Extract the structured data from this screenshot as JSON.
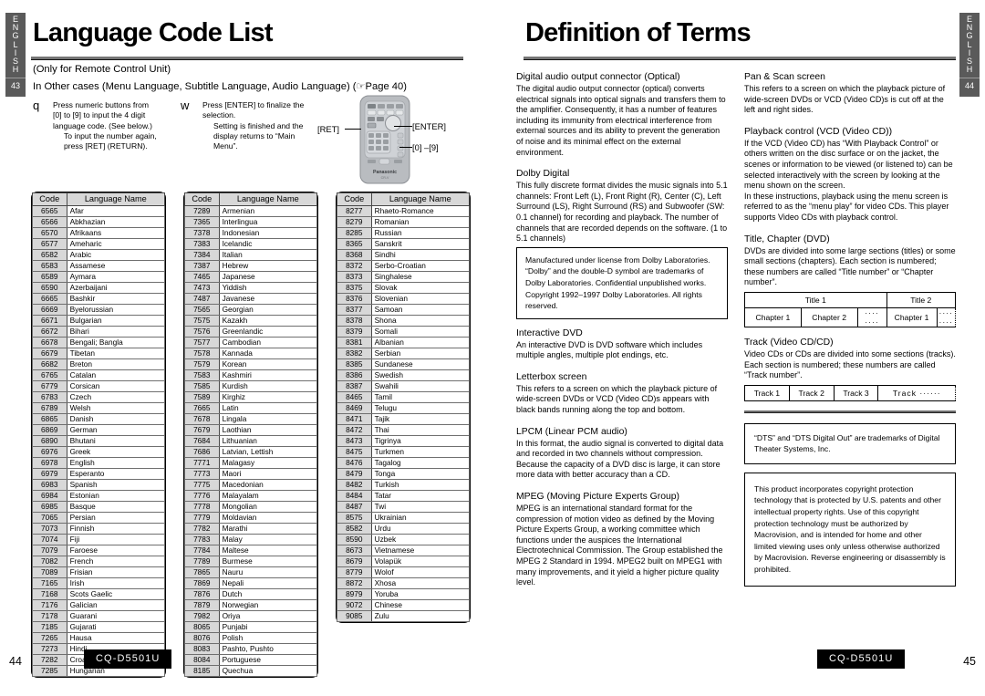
{
  "document": {
    "model": "CQ-D5501U",
    "language_tab": "ENGLISH"
  },
  "left_page": {
    "tab_page": "43",
    "folio": "44",
    "title": "Language Code List",
    "subnote_1": "(Only for Remote Control Unit)",
    "subnote_2": "In  Other  cases (Menu Language, Subtitle Language, Audio Language) (☞Page 40)",
    "steps": [
      {
        "marker": "q",
        "line1": "Press numeric buttons from",
        "line2": "[0] to [9] to input the 4 digit",
        "line3": "language code. (See below.)",
        "sub1": "To input the number again,",
        "sub2": "press [RET] (RETURN)."
      },
      {
        "marker": "w",
        "line1": "Press [ENTER] to finalize the",
        "line2": "selection.",
        "sub1": "Setting is finished and the",
        "sub2": "display returns to “Main",
        "sub3": "Menu”."
      }
    ],
    "remote": {
      "brand": "Panasonic",
      "sub_brand": "CR-V",
      "callout_ret": "[RET]",
      "callout_enter": "[ENTER]",
      "callout_digits": "[0] –[9]"
    },
    "table_headers": {
      "code": "Code",
      "name": "Language Name"
    },
    "columns": [
      [
        [
          "6565",
          "Afar"
        ],
        [
          "6566",
          "Abkhazian"
        ],
        [
          "6570",
          "Afrikaans"
        ],
        [
          "6577",
          "Ameharic"
        ],
        [
          "6582",
          "Arabic"
        ],
        [
          "6583",
          "Assamese"
        ],
        [
          "6589",
          "Aymara"
        ],
        [
          "6590",
          "Azerbaijani"
        ],
        [
          "6665",
          "Bashkir"
        ],
        [
          "6669",
          "Byelorussian"
        ],
        [
          "6671",
          "Bulgarian"
        ],
        [
          "6672",
          "Bihari"
        ],
        [
          "6678",
          "Bengali; Bangla"
        ],
        [
          "6679",
          "Tibetan"
        ],
        [
          "6682",
          "Breton"
        ],
        [
          "6765",
          "Catalan"
        ],
        [
          "6779",
          "Corsican"
        ],
        [
          "6783",
          "Czech"
        ],
        [
          "6789",
          "Welsh"
        ],
        [
          "6865",
          "Danish"
        ],
        [
          "6869",
          "German"
        ],
        [
          "6890",
          "Bhutani"
        ],
        [
          "6976",
          "Greek"
        ],
        [
          "6978",
          "English"
        ],
        [
          "6979",
          "Esperanto"
        ],
        [
          "6983",
          "Spanish"
        ],
        [
          "6984",
          "Estonian"
        ],
        [
          "6985",
          "Basque"
        ],
        [
          "7065",
          "Persian"
        ],
        [
          "7073",
          "Finnish"
        ],
        [
          "7074",
          "Fiji"
        ],
        [
          "7079",
          "Faroese"
        ],
        [
          "7082",
          "French"
        ],
        [
          "7089",
          "Frisian"
        ],
        [
          "7165",
          "Irish"
        ],
        [
          "7168",
          "Scots Gaelic"
        ],
        [
          "7176",
          "Galician"
        ],
        [
          "7178",
          "Guarani"
        ],
        [
          "7185",
          "Gujarati"
        ],
        [
          "7265",
          "Hausa"
        ],
        [
          "7273",
          "Hindi"
        ],
        [
          "7282",
          "Croatian"
        ],
        [
          "7285",
          "Hungarian"
        ]
      ],
      [
        [
          "7289",
          "Armenian"
        ],
        [
          "7365",
          "Interlingua"
        ],
        [
          "7378",
          "Indonesian"
        ],
        [
          "7383",
          "Icelandic"
        ],
        [
          "7384",
          "Italian"
        ],
        [
          "7387",
          "Hebrew"
        ],
        [
          "7465",
          "Japanese"
        ],
        [
          "7473",
          "Yiddish"
        ],
        [
          "7487",
          "Javanese"
        ],
        [
          "7565",
          "Georgian"
        ],
        [
          "7575",
          "Kazakh"
        ],
        [
          "7576",
          "Greenlandic"
        ],
        [
          "7577",
          "Cambodian"
        ],
        [
          "7578",
          "Kannada"
        ],
        [
          "7579",
          "Korean"
        ],
        [
          "7583",
          "Kashmiri"
        ],
        [
          "7585",
          "Kurdish"
        ],
        [
          "7589",
          "Kirghiz"
        ],
        [
          "7665",
          "Latin"
        ],
        [
          "7678",
          "Lingala"
        ],
        [
          "7679",
          "Laothian"
        ],
        [
          "7684",
          "Lithuanian"
        ],
        [
          "7686",
          "Latvian, Lettish"
        ],
        [
          "7771",
          "Malagasy"
        ],
        [
          "7773",
          "Maori"
        ],
        [
          "7775",
          "Macedonian"
        ],
        [
          "7776",
          "Malayalam"
        ],
        [
          "7778",
          "Mongolian"
        ],
        [
          "7779",
          "Moldavian"
        ],
        [
          "7782",
          "Marathi"
        ],
        [
          "7783",
          "Malay"
        ],
        [
          "7784",
          "Maltese"
        ],
        [
          "7789",
          "Burmese"
        ],
        [
          "7865",
          "Nauru"
        ],
        [
          "7869",
          "Nepali"
        ],
        [
          "7876",
          "Dutch"
        ],
        [
          "7879",
          "Norwegian"
        ],
        [
          "7982",
          "Oriya"
        ],
        [
          "8065",
          "Punjabi"
        ],
        [
          "8076",
          "Polish"
        ],
        [
          "8083",
          "Pashto, Pushto"
        ],
        [
          "8084",
          "Portuguese"
        ],
        [
          "8185",
          "Quechua"
        ]
      ],
      [
        [
          "8277",
          "Rhaeto-Romance"
        ],
        [
          "8279",
          "Romanian"
        ],
        [
          "8285",
          "Russian"
        ],
        [
          "8365",
          "Sanskrit"
        ],
        [
          "8368",
          "Sindhi"
        ],
        [
          "8372",
          "Serbo-Croatian"
        ],
        [
          "8373",
          "Singhalese"
        ],
        [
          "8375",
          "Slovak"
        ],
        [
          "8376",
          "Slovenian"
        ],
        [
          "8377",
          "Samoan"
        ],
        [
          "8378",
          "Shona"
        ],
        [
          "8379",
          "Somali"
        ],
        [
          "8381",
          "Albanian"
        ],
        [
          "8382",
          "Serbian"
        ],
        [
          "8385",
          "Sundanese"
        ],
        [
          "8386",
          "Swedish"
        ],
        [
          "8387",
          "Swahili"
        ],
        [
          "8465",
          "Tamil"
        ],
        [
          "8469",
          "Telugu"
        ],
        [
          "8471",
          "Tajik"
        ],
        [
          "8472",
          "Thai"
        ],
        [
          "8473",
          "Tigrinya"
        ],
        [
          "8475",
          "Turkmen"
        ],
        [
          "8476",
          "Tagalog"
        ],
        [
          "8479",
          "Tonga"
        ],
        [
          "8482",
          "Turkish"
        ],
        [
          "8484",
          "Tatar"
        ],
        [
          "8487",
          "Twi"
        ],
        [
          "8575",
          "Ukrainian"
        ],
        [
          "8582",
          "Urdu"
        ],
        [
          "8590",
          "Uzbek"
        ],
        [
          "8673",
          "Vietnamese"
        ],
        [
          "8679",
          "Volapük"
        ],
        [
          "8779",
          "Wolof"
        ],
        [
          "8872",
          "Xhosa"
        ],
        [
          "8979",
          "Yoruba"
        ],
        [
          "9072",
          "Chinese"
        ],
        [
          "9085",
          "Zulu"
        ]
      ]
    ]
  },
  "right_page": {
    "tab_page": "44",
    "folio": "45",
    "title": "Definition of Terms",
    "left_column": [
      {
        "head": "Digital audio output connector (Optical)",
        "body": "The digital audio output connector (optical) converts electrical signals into optical signals and transfers them to the amplifier. Consequently, it has a number of features including its immunity from electrical interference from external sources and its ability to prevent the generation of noise and its minimal effect on the external environment."
      },
      {
        "head": "Dolby Digital",
        "body": "This fully discrete format divides the music signals into 5.1 channels: Front Left (L), Front Right (R), Center (C), Left Surround (LS), Right Surround (RS) and Subwoofer (SW: 0.1 channel) for recording and playback. The number of channels that are recorded depends on the software. (1 to 5.1 channels)"
      },
      {
        "head": "Interactive DVD",
        "body": "An interactive DVD is DVD software which includes multiple angles, multiple plot endings, etc."
      },
      {
        "head": "Letterbox screen",
        "body": "This refers to a screen on which the playback picture of wide-screen DVDs or VCD (Video CD)s appears with black bands running along the top and bottom."
      },
      {
        "head": "LPCM (Linear PCM audio)",
        "body": "In this format, the audio signal is converted to digital data and recorded in two channels without compression. Because the capacity of a DVD disc is large, it can store more data with better accuracy than a CD."
      },
      {
        "head": "MPEG (Moving Picture Experts Group)",
        "body": "MPEG is an international standard format for the compression of motion video as defined by the Moving Picture Experts Group, a working committee which functions under the auspices the International Electrotechnical Commission. The Group established the MPEG 2 Standard in 1994. MPEG2 built on MPEG1 with many improvements, and it yield a higher picture quality level."
      }
    ],
    "dolby_notice": "Manufactured under license from Dolby Laboratories. “Dolby” and the double-D symbol are trademarks of Dolby Laboratories. Confidential unpublished works. Copyright 1992–1997 Dolby Laboratories. All rights reserved.",
    "right_column": [
      {
        "head": "Pan & Scan screen",
        "body": "This refers to a screen on which the playback picture of wide-screen DVDs or VCD (Video CD)s is cut off at the left and right sides."
      },
      {
        "head": "Playback control (VCD (Video CD))",
        "body": "If the VCD (Video CD) has “With Playback Control” or others written on the disc surface or on the jacket, the scenes or information to be viewed (or listened to) can be selected interactively with the screen by looking at the menu shown on the screen.\nIn these instructions, playback using the menu screen is referred to as the “menu play” for video CDs. This player supports Video CDs with playback control."
      },
      {
        "head": "Title, Chapter (DVD)",
        "body": "DVDs are divided into some large sections (titles) or some small sections (chapters). Each section is numbered; these numbers are called “Title number” or “Chapter number”."
      },
      {
        "head": "Track (Video CD/CD)",
        "body": "Video CDs or CDs are divided into some sections (tracks). Each section is numbered; these numbers are called “Track number”."
      }
    ],
    "title_diagram": {
      "title_1": "Title 1",
      "title_2": "Title 2",
      "chapter_1a": "Chapter 1",
      "chapter_2a": "Chapter 2",
      "dots_a": "···· ····",
      "chapter_1b": "Chapter 1",
      "dots_b": "···· ····"
    },
    "track_diagram": {
      "track_1": "Track 1",
      "track_2": "Track 2",
      "track_3": "Track 3",
      "track_more": "Track ······"
    },
    "dts_notice": "“DTS” and “DTS Digital Out” are trademarks of Digital Theater Systems, Inc.",
    "macrovision_notice": "This product incorporates copyright protection technology that is protected by U.S. patents and other intellectual property rights. Use of this copyright protection technology must be authorized by Macrovision, and is intended for home and other limited viewing uses only unless otherwise authorized by Macrovision. Reverse engineering or disassembly is prohibited."
  }
}
